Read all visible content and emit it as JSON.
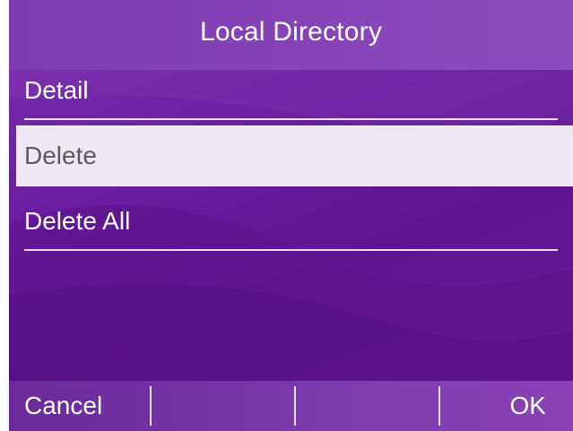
{
  "title": "Local Directory",
  "menu": {
    "items": [
      {
        "label": "Detail",
        "selected": false
      },
      {
        "label": "Delete",
        "selected": true
      },
      {
        "label": "Delete All",
        "selected": false
      }
    ]
  },
  "softkeys": {
    "left": "Cancel",
    "right": "OK"
  },
  "colors": {
    "background": "#6a1fa0",
    "title_bar": "#8643b8",
    "selected_row": "#efe8f4",
    "selected_text": "#5a5a5a"
  }
}
